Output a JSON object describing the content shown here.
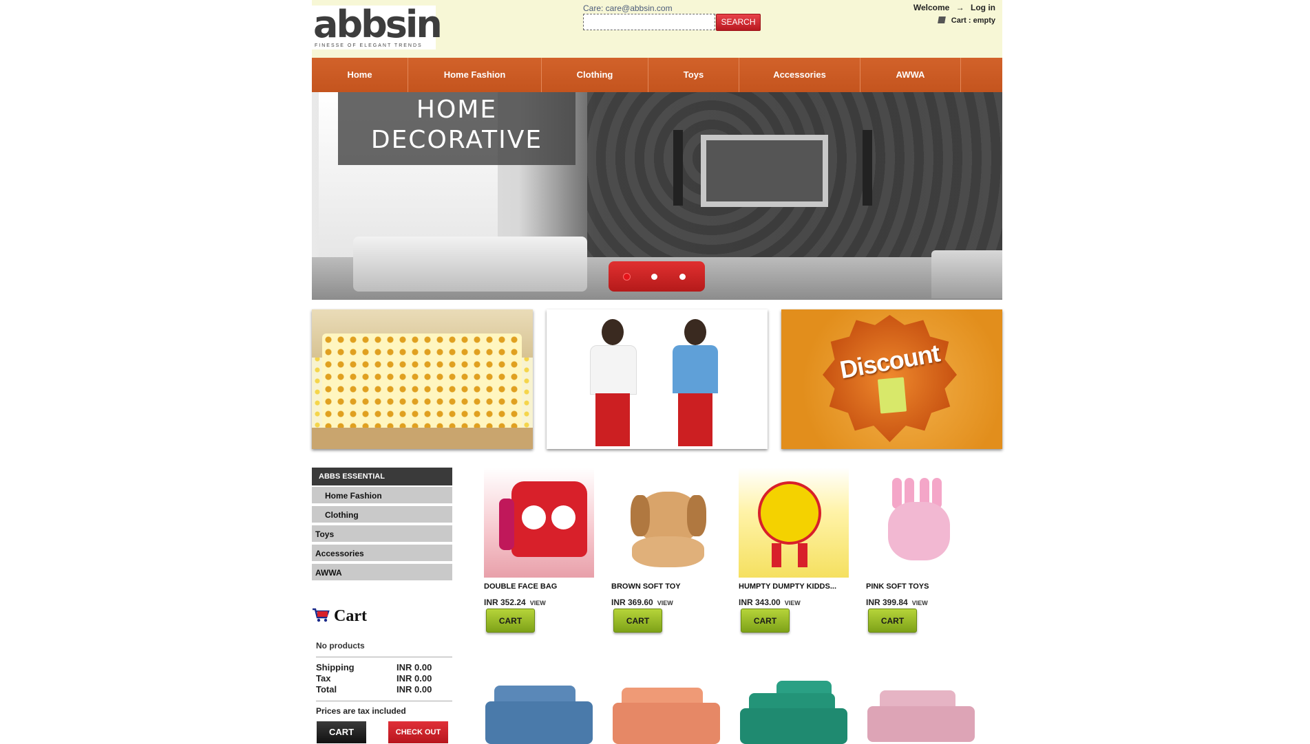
{
  "header": {
    "logo_text": "abbsin",
    "logo_tagline": "FINESSE OF ELEGANT TRENDS",
    "care": "Care: care@abbsin.com",
    "search_value": "",
    "search_button": "SEARCH",
    "welcome": "Welcome",
    "login": "Log in",
    "cart_label": "Cart :",
    "cart_status": "empty"
  },
  "nav": {
    "items": [
      {
        "label": "Home"
      },
      {
        "label": "Home Fashion"
      },
      {
        "label": "Clothing"
      },
      {
        "label": "Toys"
      },
      {
        "label": "Accessories"
      },
      {
        "label": "AWWA"
      }
    ]
  },
  "hero": {
    "title_line1": "HOME",
    "title_line2": "DECORATIVE",
    "slides": 3,
    "active_slide": 1
  },
  "banners": {
    "discount_text": "Discount"
  },
  "sidebar": {
    "heading": "ABBS ESSENTIAL",
    "items": [
      {
        "label": "Home Fashion"
      },
      {
        "label": "Clothing"
      },
      {
        "label": "Toys"
      },
      {
        "label": "Accessories"
      },
      {
        "label": "AWWA"
      }
    ]
  },
  "cart": {
    "title": "Cart",
    "no_products": "No products",
    "shipping_label": "Shipping",
    "shipping_value": "INR 0.00",
    "tax_label": "Tax",
    "tax_value": "INR 0.00",
    "total_label": "Total",
    "total_value": "INR 0.00",
    "tax_note": "Prices are tax included",
    "cart_button": "CART",
    "checkout_button": "CHECK OUT"
  },
  "products": [
    {
      "name": "DOUBLE FACE BAG",
      "price": "INR 352.24",
      "view": "VIEW",
      "button": "CART"
    },
    {
      "name": "BROWN SOFT TOY",
      "price": "INR 369.60",
      "view": "VIEW",
      "button": "CART"
    },
    {
      "name": "HUMPTY DUMPTY KIDDS...",
      "price": "INR 343.00",
      "view": "VIEW",
      "button": "CART"
    },
    {
      "name": "PINK SOFT TOYS",
      "price": "INR 399.84",
      "view": "VIEW",
      "button": "CART"
    }
  ],
  "colors": {
    "header_bg": "#f7f7d6",
    "nav_orange": "#c9581f",
    "search_red": "#d0282f",
    "cart_green": "#97bb28",
    "sidebar_dark": "#3a3a3a",
    "sidebar_grey": "#c9c9c9"
  }
}
